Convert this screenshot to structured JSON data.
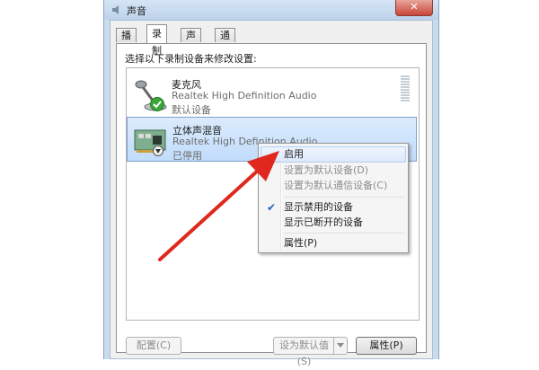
{
  "window": {
    "title": "声音",
    "close_glyph": "✕"
  },
  "tabs": [
    {
      "label": "播放",
      "active": false
    },
    {
      "label": "录制",
      "active": true
    },
    {
      "label": "声音",
      "active": false
    },
    {
      "label": "通信",
      "active": false
    }
  ],
  "instruction": "选择以下录制设备来修改设置:",
  "devices": [
    {
      "name": "麦克风",
      "driver": "Realtek High Definition Audio",
      "status": "默认设备",
      "icon": "microphone-icon",
      "badge": "default-check-icon"
    },
    {
      "name": "立体声混音",
      "driver": "Realtek High Definition Audio",
      "status": "已停用",
      "icon": "sound-card-icon",
      "badge": "disabled-arrow-icon"
    }
  ],
  "context_menu": {
    "items": [
      {
        "label": "启用",
        "enabled": true,
        "highlighted": true
      },
      {
        "label": "设置为默认设备(D)",
        "enabled": false
      },
      {
        "label": "设置为默认通信设备(C)",
        "enabled": false
      },
      {
        "label": "显示禁用的设备",
        "enabled": true,
        "checked": true
      },
      {
        "label": "显示已断开的设备",
        "enabled": true
      },
      {
        "label": "属性(P)",
        "enabled": true
      }
    ]
  },
  "buttons": {
    "configure": "配置(C)",
    "set_default": "设为默认值(S)",
    "properties": "属性(P)"
  },
  "colors": {
    "annotation_arrow": "#e0281e",
    "check": "#2a5fbf",
    "selection": "#c1dcfc"
  }
}
